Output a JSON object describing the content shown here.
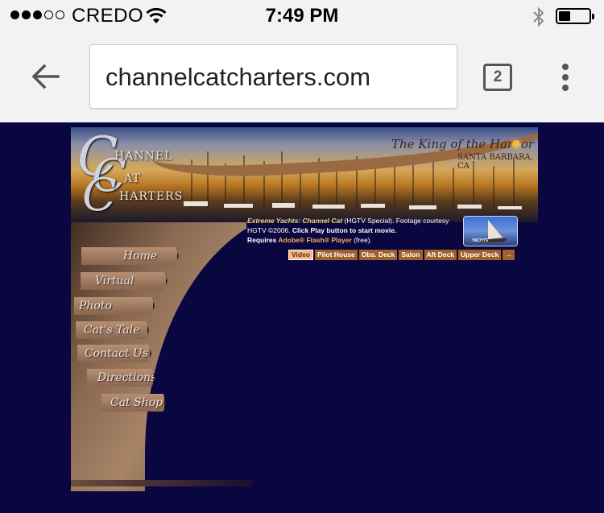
{
  "status_bar": {
    "carrier": "CREDO",
    "time": "7:49 PM",
    "signal_bars_filled": 3,
    "signal_bars_total": 5,
    "battery_level": 0.35
  },
  "browser": {
    "url": "channelcatcharters.com",
    "tab_count": "2"
  },
  "site": {
    "logo_letter_c1": "C",
    "logo_letter_c2": "C",
    "logo_letter_c3": "C",
    "logo_word_1": "HANNEL",
    "logo_word_2": "AT",
    "logo_word_3": "HARTERS",
    "tagline": "The King of the Harbor",
    "location": "SANTA BARBARA, CA",
    "nav": [
      {
        "label": "Home"
      },
      {
        "label": "Virtual Tours"
      },
      {
        "label": "Photo Gallery"
      },
      {
        "label": "Cat's Tale"
      },
      {
        "label": "Contact Us"
      },
      {
        "label": "Directions"
      },
      {
        "label": "Cat Shop"
      }
    ],
    "blurb": {
      "title": "Extreme Yachts: Channel Cat",
      "part1": " (HGTV Special). Footage courtesy HGTV ©2006. ",
      "bold_instruction": "Click Play button to start movie.",
      "requires": "Requires ",
      "flash": "Adobe® Flash® Player",
      "free": " (free)."
    },
    "thumb_label": "YACHTS",
    "tabs": [
      {
        "label": "Video",
        "active": true
      },
      {
        "label": "Pilot House",
        "active": false
      },
      {
        "label": "Obs. Deck",
        "active": false
      },
      {
        "label": "Salon",
        "active": false
      },
      {
        "label": "Aft Deck",
        "active": false
      },
      {
        "label": "Upper Deck",
        "active": false
      },
      {
        "label": "→",
        "active": false
      }
    ]
  },
  "colors": {
    "page_background": "#0a0640",
    "tab_orange": "#a0602a",
    "active_tab": "#f3b78a",
    "chrome_gray": "#f2f2f2"
  }
}
